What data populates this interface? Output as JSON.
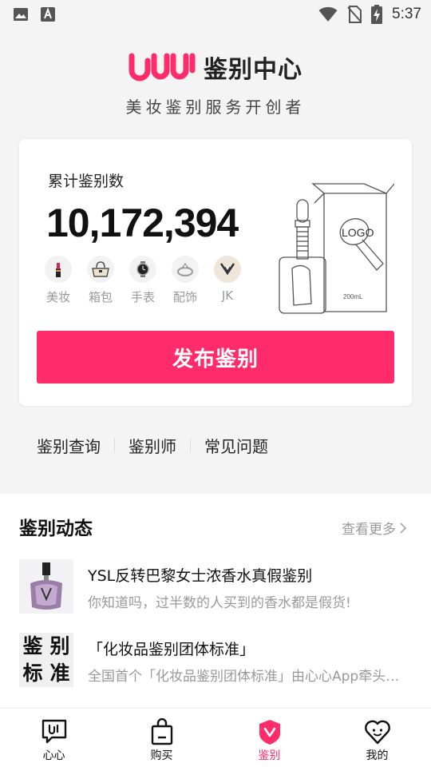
{
  "status_bar": {
    "time": "5:37",
    "icons": [
      "image-icon",
      "text-notification-icon",
      "wifi-icon",
      "no-sim-icon",
      "battery-charging-icon"
    ]
  },
  "header": {
    "logo_text": "鉴别中心",
    "slogan": "美妆鉴别服务开创者",
    "brand_color": "#ff2b6a"
  },
  "card": {
    "count_label": "累计鉴别数",
    "count_value": "10,172,394",
    "categories": [
      {
        "label": "美妆",
        "icon": "lipstick-icon"
      },
      {
        "label": "箱包",
        "icon": "handbag-icon"
      },
      {
        "label": "手表",
        "icon": "watch-icon"
      },
      {
        "label": "配饰",
        "icon": "ring-icon"
      },
      {
        "label": "JK",
        "icon": "jk-collar-icon"
      }
    ],
    "illustration_text": {
      "logo": "LOGO",
      "volume": "200mL"
    },
    "publish_button": "发布鉴别"
  },
  "quick_links": [
    "鉴别查询",
    "鉴别师",
    "常见问题"
  ],
  "feed": {
    "title": "鉴别动态",
    "more": "查看更多",
    "items": [
      {
        "title": "YSL反转巴黎女士浓香水真假鉴别",
        "desc": "你知道吗，过半数的人买到的香水都是假货!",
        "thumb": "perfume-bottle-image"
      },
      {
        "title": "「化妆品鉴别团体标准」",
        "desc": "全国首个「化妆品鉴别团体标准」由心心App牵头…",
        "thumb_chars": [
          "鉴",
          "别",
          "标",
          "准"
        ]
      }
    ]
  },
  "bottom_nav": {
    "items": [
      {
        "label": "心心",
        "icon": "chat-bubble-icon",
        "active": false
      },
      {
        "label": "购买",
        "icon": "shopping-bag-icon",
        "active": false
      },
      {
        "label": "鉴别",
        "icon": "shield-badge-icon",
        "active": true
      },
      {
        "label": "我的",
        "icon": "heart-face-icon",
        "active": false
      }
    ],
    "active_color": "#ff2b6a"
  }
}
